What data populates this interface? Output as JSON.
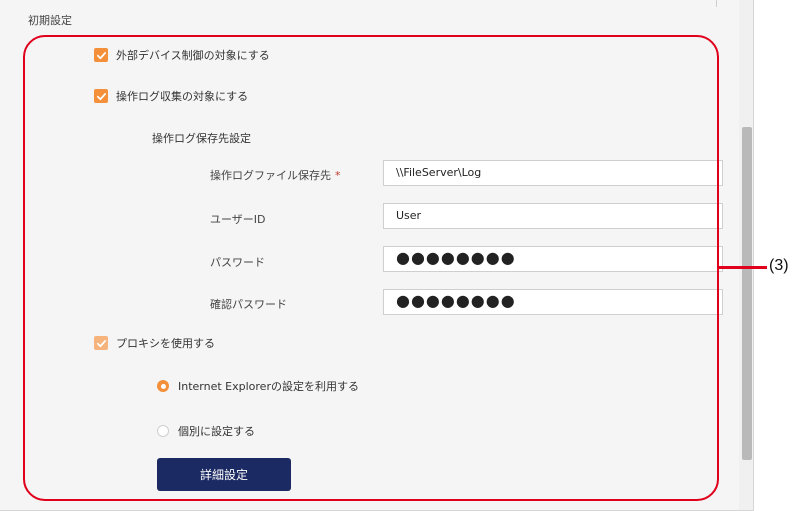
{
  "section": {
    "title": "初期設定"
  },
  "options": {
    "external_device": {
      "label": "外部デバイス制御の対象にする",
      "checked": true
    },
    "operation_log": {
      "label": "操作ログ収集の対象にする",
      "checked": true
    },
    "proxy": {
      "label": "プロキシを使用する",
      "checked": true
    }
  },
  "log_settings": {
    "heading": "操作ログ保存先設定",
    "destination": {
      "label": "操作ログファイル保存先",
      "required_mark": "*",
      "value": "\\\\FileServer\\Log"
    },
    "user_id": {
      "label": "ユーザーID",
      "value": "User"
    },
    "password": {
      "label": "パスワード",
      "value": "●●●●●●●●"
    },
    "confirm_password": {
      "label": "確認パスワード",
      "value": "●●●●●●●●"
    }
  },
  "proxy_options": {
    "ie": {
      "label": "Internet Explorerの設定を利用する",
      "selected": true
    },
    "manual": {
      "label": "個別に設定する",
      "selected": false
    }
  },
  "buttons": {
    "advanced": "詳細設定"
  },
  "callout": {
    "label": "(3)"
  },
  "colors": {
    "accent": "#f4903a",
    "button": "#1b2a63",
    "callout": "#e0001b"
  },
  "icons": {
    "checkbox": "check-icon"
  }
}
